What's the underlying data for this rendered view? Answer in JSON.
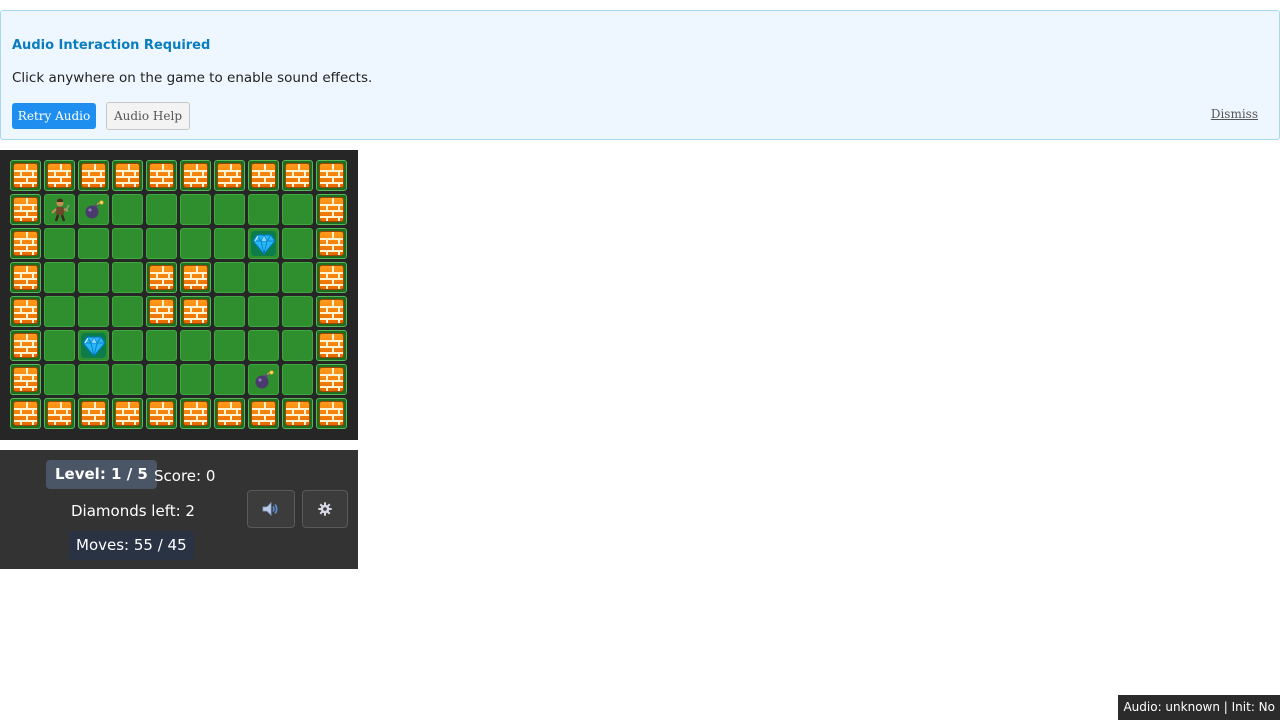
{
  "banner": {
    "title": "Audio Interaction Required",
    "message": "Click anywhere on the game to enable sound effects.",
    "retry_label": "Retry Audio",
    "help_label": "Audio Help",
    "dismiss_label": "Dismiss"
  },
  "board": {
    "cols": 10,
    "rows": 8,
    "legend": {
      "#": "wall",
      ".": "grass",
      "P": "player",
      "B": "bomb",
      "D": "diamond"
    },
    "grid": [
      "##########",
      "#PB......#",
      "#......D.#",
      "#...##...#",
      "#...##...#",
      "#.D......#",
      "#......B.#",
      "##########"
    ],
    "icons": {
      "wall": "brick-wall-icon",
      "player": "explorer-icon",
      "bomb": "bomb-icon",
      "diamond": "diamond-icon"
    }
  },
  "hud": {
    "level": "Level: 1 / 5",
    "score": "Score: 0",
    "diamonds_left": "Diamonds left: 2",
    "moves": "Moves: 55 / 45",
    "sound_icon": "speaker-icon",
    "settings_icon": "gear-icon"
  },
  "status": {
    "text": "Audio: unknown | Init: No"
  },
  "colors": {
    "accent": "#1e8ff0",
    "banner_title": "#0a7cc0",
    "grass": "#2f8f2f",
    "brick": "#ff9a1a"
  }
}
